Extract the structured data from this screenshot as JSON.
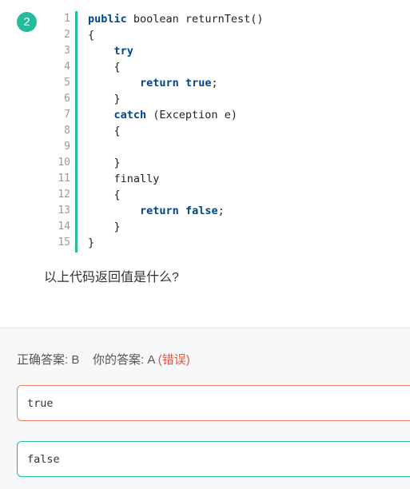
{
  "question_number": "2",
  "code": {
    "line_numbers": [
      "1",
      "2",
      "3",
      "4",
      "5",
      "6",
      "7",
      "8",
      "9",
      "10",
      "11",
      "12",
      "13",
      "14",
      "15"
    ],
    "lines": [
      [
        {
          "t": "public",
          "k": true
        },
        {
          "t": " boolean returnTest()",
          "k": false
        }
      ],
      [
        {
          "t": "{",
          "k": false
        }
      ],
      [
        {
          "t": "    ",
          "k": false
        },
        {
          "t": "try",
          "k": true
        }
      ],
      [
        {
          "t": "    {",
          "k": false
        }
      ],
      [
        {
          "t": "        ",
          "k": false
        },
        {
          "t": "return",
          "k": true
        },
        {
          "t": " ",
          "k": false
        },
        {
          "t": "true",
          "k": true
        },
        {
          "t": ";",
          "k": false
        }
      ],
      [
        {
          "t": "    }",
          "k": false
        }
      ],
      [
        {
          "t": "    ",
          "k": false
        },
        {
          "t": "catch",
          "k": true
        },
        {
          "t": " (Exception e)",
          "k": false
        }
      ],
      [
        {
          "t": "    {",
          "k": false
        }
      ],
      [
        {
          "t": "",
          "k": false
        }
      ],
      [
        {
          "t": "    }",
          "k": false
        }
      ],
      [
        {
          "t": "    finally",
          "k": false
        }
      ],
      [
        {
          "t": "    {",
          "k": false
        }
      ],
      [
        {
          "t": "        ",
          "k": false
        },
        {
          "t": "return",
          "k": true
        },
        {
          "t": " ",
          "k": false
        },
        {
          "t": "false",
          "k": true
        },
        {
          "t": ";",
          "k": false
        }
      ],
      [
        {
          "t": "    }",
          "k": false
        }
      ],
      [
        {
          "t": "}",
          "k": false
        }
      ]
    ]
  },
  "question_text": "以上代码返回值是什么?",
  "result": {
    "correct_label": "正确答案: B",
    "yours_label": "你的答案: A",
    "status": "(错误)"
  },
  "options": [
    {
      "text": "true",
      "state": "wrong"
    },
    {
      "text": "false",
      "state": "correct"
    }
  ],
  "colors": {
    "accent": "#25bb9b",
    "keyword": "#00468b",
    "error": "#e8543e"
  }
}
